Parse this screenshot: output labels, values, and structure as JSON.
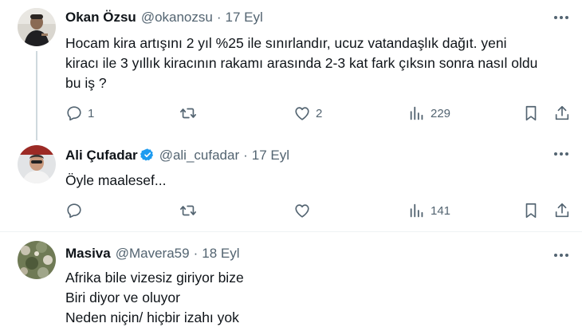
{
  "tweets": [
    {
      "name": "Okan Özsu",
      "handle": "@okanozsu",
      "separator": "·",
      "date": "17 Eyl",
      "lines": [
        "Hocam kira artışını 2 yıl %25 ile sınırlandır, ucuz vatandaşlık dağıt. yeni",
        "kiracı ile 3 yıllık kiracının rakamı arasında 2-3 kat fark çıksın sonra nasıl oldu",
        "bu iş ?"
      ],
      "replies": "1",
      "retweets": "",
      "likes": "2",
      "views": "229"
    },
    {
      "name": "Ali Çufadar",
      "handle": "@ali_cufadar",
      "separator": "·",
      "date": "17 Eyl",
      "verified": true,
      "lines": [
        "Öyle maalesef..."
      ],
      "replies": "",
      "retweets": "",
      "likes": "",
      "views": "141"
    },
    {
      "name": "Masiva",
      "handle": "@Mavera59",
      "separator": "·",
      "date": "18 Eyl",
      "lines": [
        "Afrika bile vizesiz giriyor bize",
        "Biri diyor ve oluyor",
        "Neden niçin/ hiçbir izahı yok"
      ]
    }
  ],
  "colors": {
    "text": "#0f1419",
    "muted": "#536471",
    "verified": "#1d9bf0",
    "divider": "#eff3f4",
    "thread_line": "#cfd9de"
  },
  "icons": [
    "more-icon",
    "reply-icon",
    "retweet-icon",
    "like-icon",
    "views-icon",
    "bookmark-icon",
    "share-icon",
    "verified-badge-icon"
  ]
}
